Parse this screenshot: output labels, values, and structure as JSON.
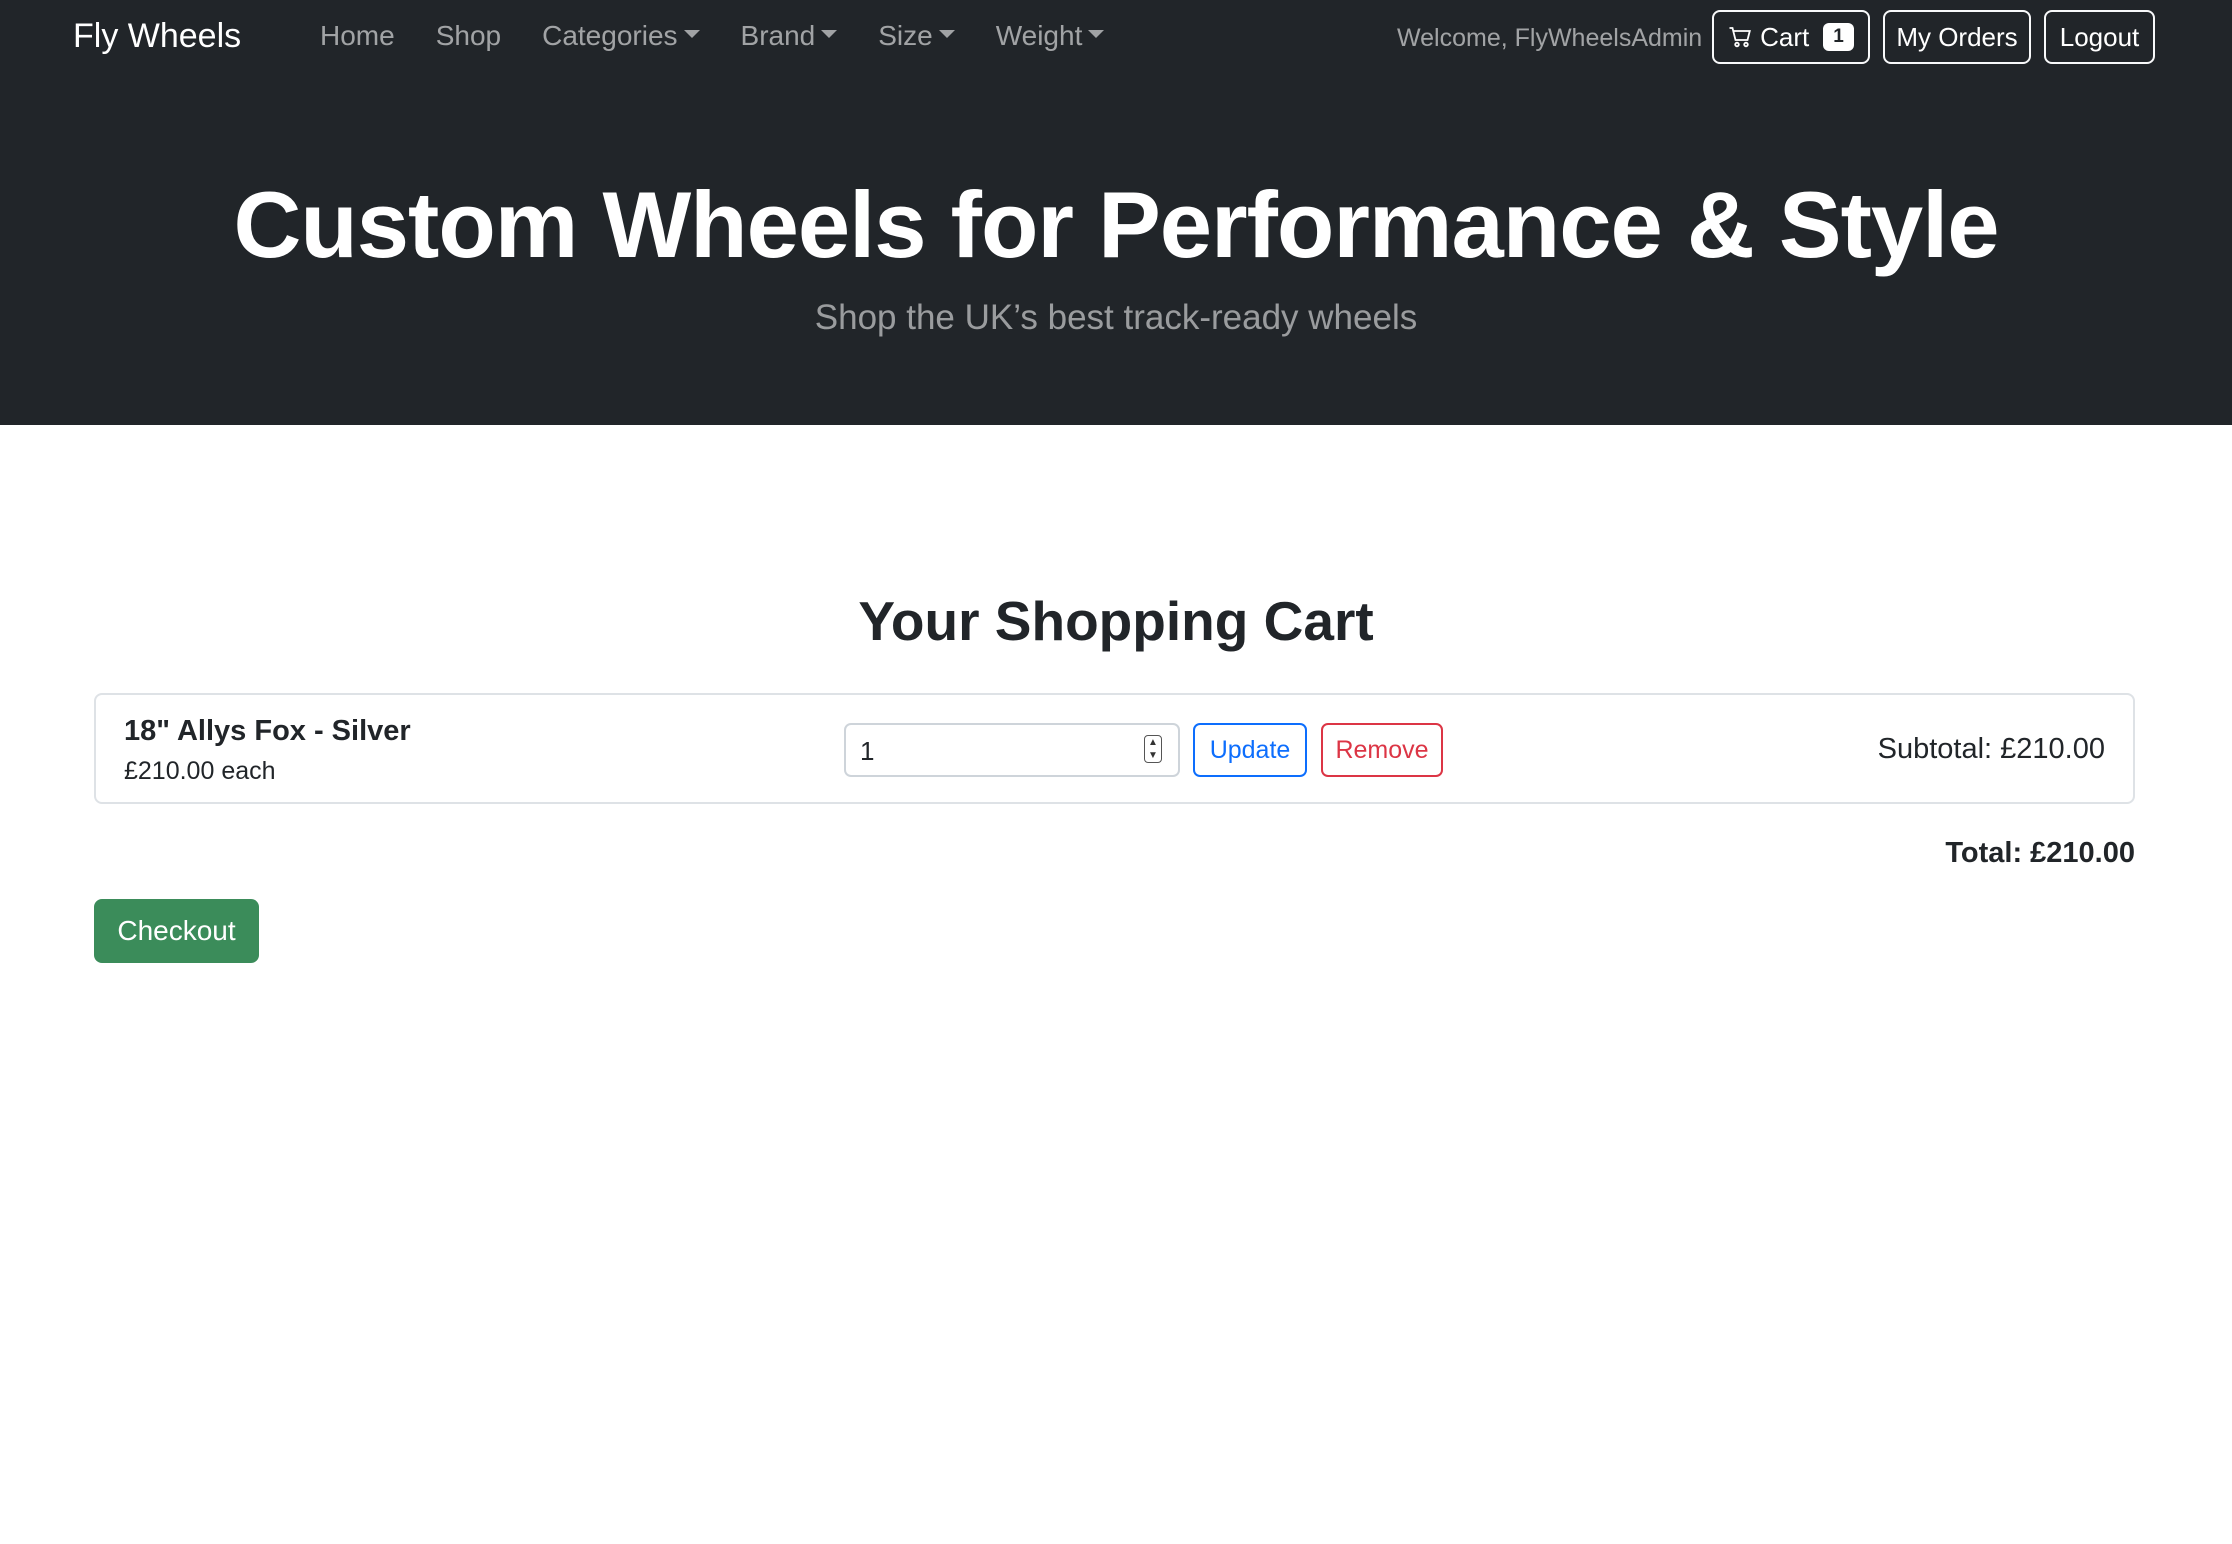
{
  "navbar": {
    "brand": "Fly Wheels",
    "links": [
      {
        "label": "Home",
        "dropdown": false
      },
      {
        "label": "Shop",
        "dropdown": false
      },
      {
        "label": "Categories",
        "dropdown": true
      },
      {
        "label": "Brand",
        "dropdown": true
      },
      {
        "label": "Size",
        "dropdown": true
      },
      {
        "label": "Weight",
        "dropdown": true
      }
    ],
    "welcome": "Welcome, FlyWheelsAdmin",
    "cart_label": "Cart",
    "cart_count": "1",
    "orders_label": "My Orders",
    "logout_label": "Logout"
  },
  "hero": {
    "title": "Custom Wheels for Performance & Style",
    "subtitle": "Shop the UK’s best track-ready wheels"
  },
  "cart": {
    "heading": "Your Shopping Cart",
    "items": [
      {
        "name": "18\" Allys Fox - Silver",
        "unit_price": "£210.00 each",
        "quantity": "1",
        "update_label": "Update",
        "remove_label": "Remove",
        "subtotal": "Subtotal: £210.00"
      }
    ],
    "total": "Total: £210.00",
    "checkout_label": "Checkout"
  },
  "colors": {
    "navbar_bg": "#212529",
    "update_blue": "#0d6efd",
    "remove_red": "#dc3545",
    "checkout_green": "#3b8c5a"
  },
  "icons": {
    "cart": "cart-icon",
    "dropdown": "caret-down-icon"
  }
}
